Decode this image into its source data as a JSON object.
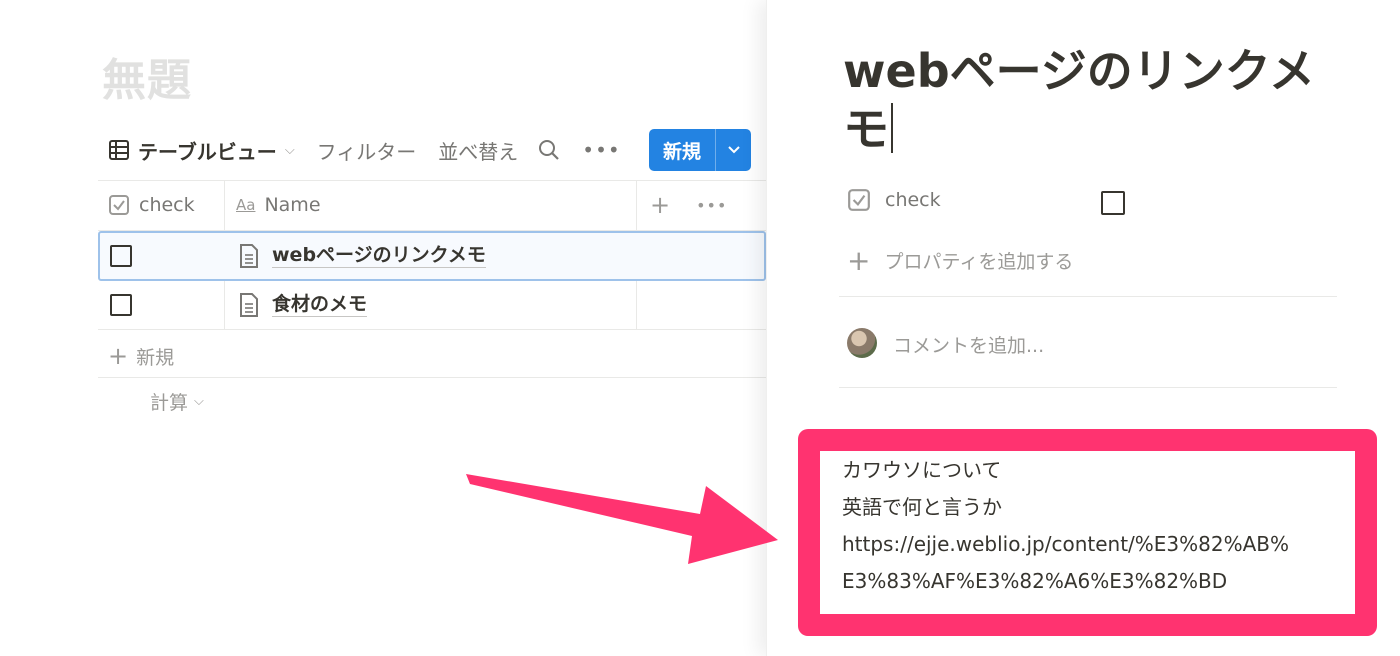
{
  "database": {
    "page_title": "無題",
    "toolbar": {
      "view_label": "テーブルビュー",
      "filter_label": "フィルター",
      "sort_label": "並べ替え",
      "new_label": "新規"
    },
    "columns": [
      {
        "name": "check",
        "icon": "checkbox-property-icon"
      },
      {
        "name": "Name",
        "icon": "text-property-icon"
      }
    ],
    "rows": [
      {
        "checked": false,
        "name": "webページのリンクメモ"
      },
      {
        "checked": false,
        "name": "食材のメモ"
      }
    ],
    "add_row_label": "新規",
    "calculate_label": "計算"
  },
  "peek": {
    "title": "webページのリンクメモ",
    "property_name": "check",
    "property_checked": false,
    "add_property_label": "プロパティを追加する",
    "comment_placeholder": "コメントを追加..."
  },
  "callout": {
    "lines": [
      "カワウソについて",
      "英語で何と言うか",
      "https://ejje.weblio.jp/content/%E3%82%AB%",
      "E3%83%AF%E3%82%A6%E3%82%BD"
    ],
    "border_color": "#ff3370"
  },
  "colors": {
    "accent": "#2383e2",
    "highlight": "#ff3370"
  }
}
